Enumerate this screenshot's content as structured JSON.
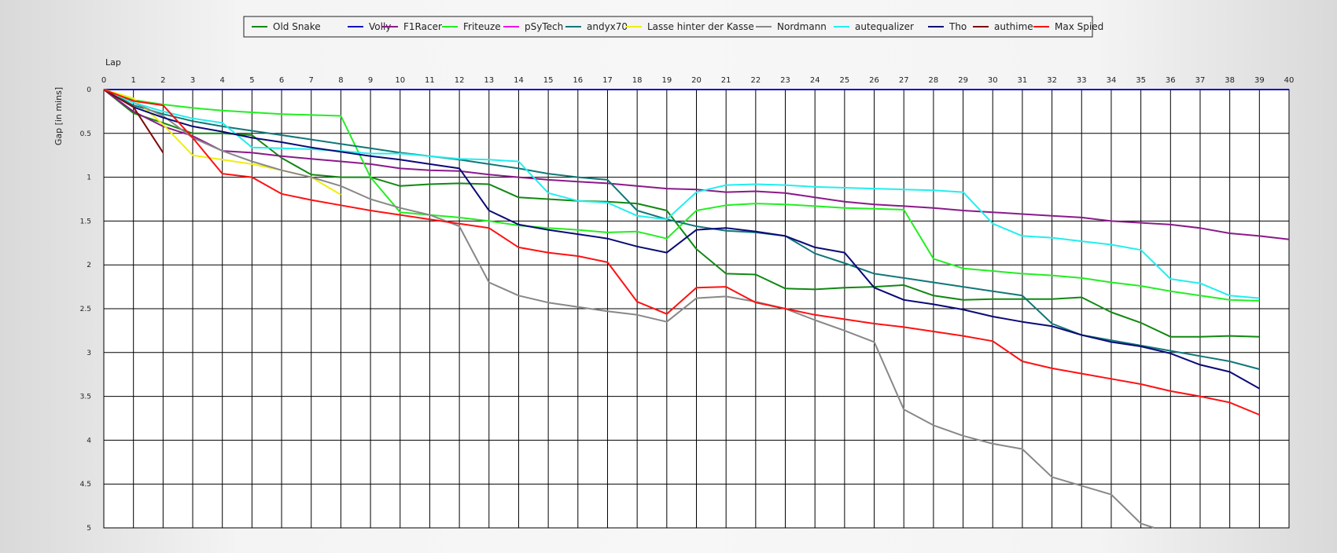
{
  "chart_data": {
    "type": "line",
    "xlabel": "Lap",
    "ylabel": "Gap [in mins]",
    "xlim": [
      0,
      40
    ],
    "ylim": [
      0,
      5
    ],
    "y_inverted": true,
    "grid": true,
    "legend_position": "top-center",
    "x_ticks": [
      "0",
      "1",
      "2",
      "3",
      "4",
      "5",
      "6",
      "7",
      "8",
      "9",
      "10",
      "11",
      "12",
      "13",
      "14",
      "15",
      "16",
      "17",
      "18",
      "19",
      "20",
      "21",
      "22",
      "23",
      "24",
      "25",
      "26",
      "27",
      "28",
      "29",
      "30",
      "31",
      "32",
      "33",
      "34",
      "35",
      "36",
      "37",
      "38",
      "39",
      "40"
    ],
    "y_ticks": [
      "0",
      "0.5",
      "1",
      "1.5",
      "2",
      "2.5",
      "3",
      "3.5",
      "4",
      "4.5",
      "5"
    ],
    "series": [
      {
        "name": "Old Snake",
        "color": "#118811",
        "x": [
          0,
          1,
          2,
          3,
          4,
          5,
          6,
          7,
          8,
          9,
          10,
          11,
          12,
          13,
          14,
          15,
          16,
          17,
          18,
          19,
          20,
          21,
          22,
          23,
          24,
          25,
          26,
          27,
          28,
          29,
          30,
          31,
          32,
          33,
          34,
          35,
          36,
          37,
          38,
          39
        ],
        "y": [
          0,
          0.27,
          0.38,
          0.5,
          0.5,
          0.52,
          0.78,
          0.97,
          1.0,
          1.0,
          1.1,
          1.08,
          1.07,
          1.08,
          1.23,
          1.25,
          1.27,
          1.28,
          1.3,
          1.38,
          1.82,
          2.1,
          2.11,
          2.27,
          2.28,
          2.26,
          2.25,
          2.23,
          2.35,
          2.4,
          2.39,
          2.39,
          2.39,
          2.37,
          2.54,
          2.66,
          2.82,
          2.82,
          2.81,
          2.82
        ]
      },
      {
        "name": "Volly",
        "color": "#1111bb",
        "x": [
          0
        ],
        "y": [
          0
        ]
      },
      {
        "name": "F1Racer",
        "color": "#8a1a8a",
        "x": [
          0,
          1,
          2,
          3,
          4,
          5,
          6,
          7,
          8,
          9,
          10,
          11,
          12,
          13,
          14,
          15,
          16,
          17,
          18,
          19,
          20,
          21,
          22,
          23,
          24,
          25,
          26,
          27,
          28,
          29,
          30,
          31,
          32,
          33,
          34,
          35,
          36,
          37,
          38,
          39,
          40
        ],
        "y": [
          0,
          0.25,
          0.42,
          0.53,
          0.7,
          0.72,
          0.76,
          0.79,
          0.82,
          0.85,
          0.9,
          0.92,
          0.93,
          0.97,
          1.0,
          1.03,
          1.05,
          1.07,
          1.1,
          1.13,
          1.14,
          1.17,
          1.16,
          1.18,
          1.23,
          1.28,
          1.31,
          1.33,
          1.35,
          1.38,
          1.4,
          1.42,
          1.44,
          1.46,
          1.5,
          1.52,
          1.54,
          1.58,
          1.64,
          1.67,
          1.71
        ]
      },
      {
        "name": "Friteuze",
        "color": "#22ee22",
        "x": [
          0,
          1,
          2,
          3,
          4,
          5,
          6,
          7,
          8,
          9,
          10,
          11,
          12,
          13,
          14,
          15,
          16,
          17,
          18,
          19,
          20,
          21,
          22,
          23,
          24,
          25,
          26,
          27,
          28,
          29,
          30,
          31,
          32,
          33,
          34,
          35,
          36,
          37,
          38,
          39
        ],
        "y": [
          0,
          0.12,
          0.17,
          0.21,
          0.24,
          0.26,
          0.28,
          0.29,
          0.3,
          1.0,
          1.4,
          1.43,
          1.46,
          1.5,
          1.55,
          1.58,
          1.6,
          1.63,
          1.62,
          1.7,
          1.38,
          1.32,
          1.3,
          1.31,
          1.33,
          1.35,
          1.36,
          1.37,
          1.93,
          2.04,
          2.07,
          2.1,
          2.12,
          2.15,
          2.2,
          2.24,
          2.3,
          2.35,
          2.4,
          2.41
        ]
      },
      {
        "name": "pSyTech",
        "color": "#ee11ee",
        "x": [
          0
        ],
        "y": [
          0
        ]
      },
      {
        "name": "andyx70",
        "color": "#117777",
        "x": [
          0,
          1,
          2,
          3,
          4,
          5,
          6,
          7,
          8,
          9,
          10,
          11,
          12,
          13,
          14,
          15,
          16,
          17,
          18,
          19,
          20,
          21,
          22,
          23,
          24,
          25,
          26,
          27,
          28,
          29,
          30,
          31,
          32,
          33,
          34,
          35,
          36,
          37,
          38,
          39
        ],
        "y": [
          0,
          0.18,
          0.28,
          0.36,
          0.42,
          0.47,
          0.52,
          0.57,
          0.62,
          0.67,
          0.72,
          0.76,
          0.8,
          0.85,
          0.9,
          0.96,
          1.0,
          1.03,
          1.38,
          1.48,
          1.56,
          1.61,
          1.63,
          1.67,
          1.87,
          1.98,
          2.1,
          2.15,
          2.2,
          2.25,
          2.3,
          2.35,
          2.67,
          2.8,
          2.86,
          2.92,
          2.98,
          3.04,
          3.1,
          3.19
        ]
      },
      {
        "name": "Lasse hinter der Kasse",
        "color": "#eeee11",
        "x": [
          0,
          1,
          2,
          3,
          4,
          5,
          6,
          7,
          8
        ],
        "y": [
          0,
          0.1,
          0.4,
          0.75,
          0.8,
          0.85,
          0.92,
          1.0,
          1.2
        ]
      },
      {
        "name": "Nordmann",
        "color": "#888888",
        "x": [
          0,
          1,
          2,
          3,
          4,
          5,
          6,
          7,
          8,
          9,
          10,
          11,
          12,
          13,
          14,
          15,
          16,
          17,
          18,
          19,
          20,
          21,
          22,
          23,
          24,
          25,
          26,
          27,
          28,
          29,
          30,
          31,
          32,
          33,
          34,
          35,
          35.45
        ],
        "y": [
          0,
          0.15,
          0.3,
          0.55,
          0.7,
          0.82,
          0.92,
          1.0,
          1.1,
          1.25,
          1.35,
          1.43,
          1.56,
          2.2,
          2.35,
          2.43,
          2.48,
          2.53,
          2.57,
          2.65,
          2.38,
          2.36,
          2.42,
          2.5,
          2.63,
          2.75,
          2.88,
          3.65,
          3.83,
          3.95,
          4.04,
          4.1,
          4.42,
          4.52,
          4.62,
          4.95,
          5.0
        ]
      },
      {
        "name": "autequalizer",
        "color": "#22eeee",
        "x": [
          0,
          1,
          2,
          3,
          4,
          5,
          6,
          7,
          8,
          9,
          10,
          11,
          12,
          13,
          14,
          15,
          16,
          17,
          18,
          19,
          20,
          21,
          22,
          23,
          24,
          25,
          26,
          27,
          28,
          29,
          30,
          31,
          32,
          33,
          34,
          35,
          36,
          37,
          38,
          39
        ],
        "y": [
          0,
          0.15,
          0.25,
          0.33,
          0.38,
          0.66,
          0.67,
          0.68,
          0.7,
          0.73,
          0.73,
          0.76,
          0.79,
          0.8,
          0.82,
          1.18,
          1.27,
          1.29,
          1.44,
          1.48,
          1.17,
          1.09,
          1.08,
          1.09,
          1.11,
          1.12,
          1.13,
          1.14,
          1.15,
          1.17,
          1.53,
          1.67,
          1.69,
          1.73,
          1.77,
          1.83,
          2.16,
          2.21,
          2.35,
          2.38
        ]
      },
      {
        "name": "Tho",
        "color": "#0a0a77",
        "x": [
          0,
          1,
          2,
          3,
          4,
          5,
          6,
          7,
          8,
          9,
          10,
          11,
          12,
          13,
          14,
          15,
          16,
          17,
          18,
          19,
          20,
          21,
          22,
          23,
          24,
          25,
          26,
          27,
          28,
          29,
          30,
          31,
          32,
          33,
          34,
          35,
          36,
          37,
          38,
          39
        ],
        "y": [
          0,
          0.2,
          0.32,
          0.42,
          0.48,
          0.55,
          0.6,
          0.66,
          0.71,
          0.76,
          0.8,
          0.85,
          0.9,
          1.38,
          1.54,
          1.6,
          1.65,
          1.7,
          1.79,
          1.86,
          1.6,
          1.58,
          1.62,
          1.67,
          1.8,
          1.86,
          2.26,
          2.4,
          2.45,
          2.51,
          2.59,
          2.65,
          2.7,
          2.8,
          2.88,
          2.93,
          3.01,
          3.14,
          3.22,
          3.41
        ]
      },
      {
        "name": "authime",
        "color": "#7a0c0c",
        "x": [
          0,
          1,
          2
        ],
        "y": [
          0,
          0.2,
          0.72
        ]
      },
      {
        "name": "Max Spied",
        "color": "#ff1111",
        "x": [
          0,
          1,
          2,
          3,
          4,
          5,
          6,
          7,
          8,
          9,
          10,
          11,
          12,
          13,
          14,
          15,
          16,
          17,
          18,
          19,
          20,
          21,
          22,
          23,
          24,
          25,
          26,
          27,
          28,
          29,
          30,
          31,
          32,
          33,
          34,
          35,
          36,
          37,
          38,
          39
        ],
        "y": [
          0,
          0.13,
          0.18,
          0.55,
          0.96,
          1.0,
          1.19,
          1.26,
          1.32,
          1.38,
          1.43,
          1.48,
          1.53,
          1.58,
          1.8,
          1.86,
          1.9,
          1.97,
          2.42,
          2.56,
          2.26,
          2.25,
          2.43,
          2.5,
          2.57,
          2.62,
          2.67,
          2.71,
          2.76,
          2.81,
          2.87,
          3.1,
          3.18,
          3.24,
          3.3,
          3.36,
          3.44,
          3.5,
          3.57,
          3.71
        ]
      }
    ]
  }
}
